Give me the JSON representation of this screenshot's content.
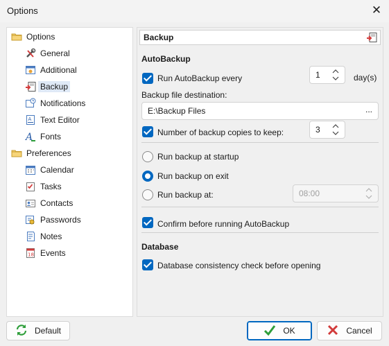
{
  "window": {
    "title": "Options"
  },
  "tree": {
    "nodes": [
      {
        "label": "Options",
        "icon": "folder-icon",
        "level": 0
      },
      {
        "label": "General",
        "icon": "tools-icon",
        "level": 1
      },
      {
        "label": "Additional",
        "icon": "additional-icon",
        "level": 1
      },
      {
        "label": "Backup",
        "icon": "backup-icon",
        "level": 1,
        "selected": true
      },
      {
        "label": "Notifications",
        "icon": "notifications-icon",
        "level": 1
      },
      {
        "label": "Text Editor",
        "icon": "text-editor-icon",
        "level": 1
      },
      {
        "label": "Fonts",
        "icon": "fonts-icon",
        "level": 1
      },
      {
        "label": "Preferences",
        "icon": "folder-icon",
        "level": 0
      },
      {
        "label": "Calendar",
        "icon": "calendar-icon",
        "level": 1
      },
      {
        "label": "Tasks",
        "icon": "tasks-icon",
        "level": 1
      },
      {
        "label": "Contacts",
        "icon": "contacts-icon",
        "level": 1
      },
      {
        "label": "Passwords",
        "icon": "passwords-icon",
        "level": 1
      },
      {
        "label": "Notes",
        "icon": "notes-icon",
        "level": 1
      },
      {
        "label": "Events",
        "icon": "events-icon",
        "level": 1
      }
    ]
  },
  "panel": {
    "header": "Backup",
    "autobackup_section": "AutoBackup",
    "run_autobackup_label": "Run AutoBackup every",
    "run_autobackup_value": "1",
    "run_autobackup_unit": "day(s)",
    "destination_label": "Backup file destination:",
    "destination_value": "E:\\Backup Files",
    "browse_label": "...",
    "copies_label": "Number of backup copies to keep:",
    "copies_value": "3",
    "radio_startup": "Run backup at startup",
    "radio_exit": "Run backup on exit",
    "radio_at": "Run backup at:",
    "time_value": "08:00",
    "confirm_label": "Confirm before running AutoBackup",
    "database_section": "Database",
    "db_check_label": "Database consistency check before opening"
  },
  "footer": {
    "default_label": "Default",
    "ok_label": "OK",
    "cancel_label": "Cancel"
  },
  "colors": {
    "accent": "#0067c0",
    "folder": "#e8b93a",
    "ok_check": "#2e9e3a",
    "cancel_x": "#d23b3b"
  }
}
